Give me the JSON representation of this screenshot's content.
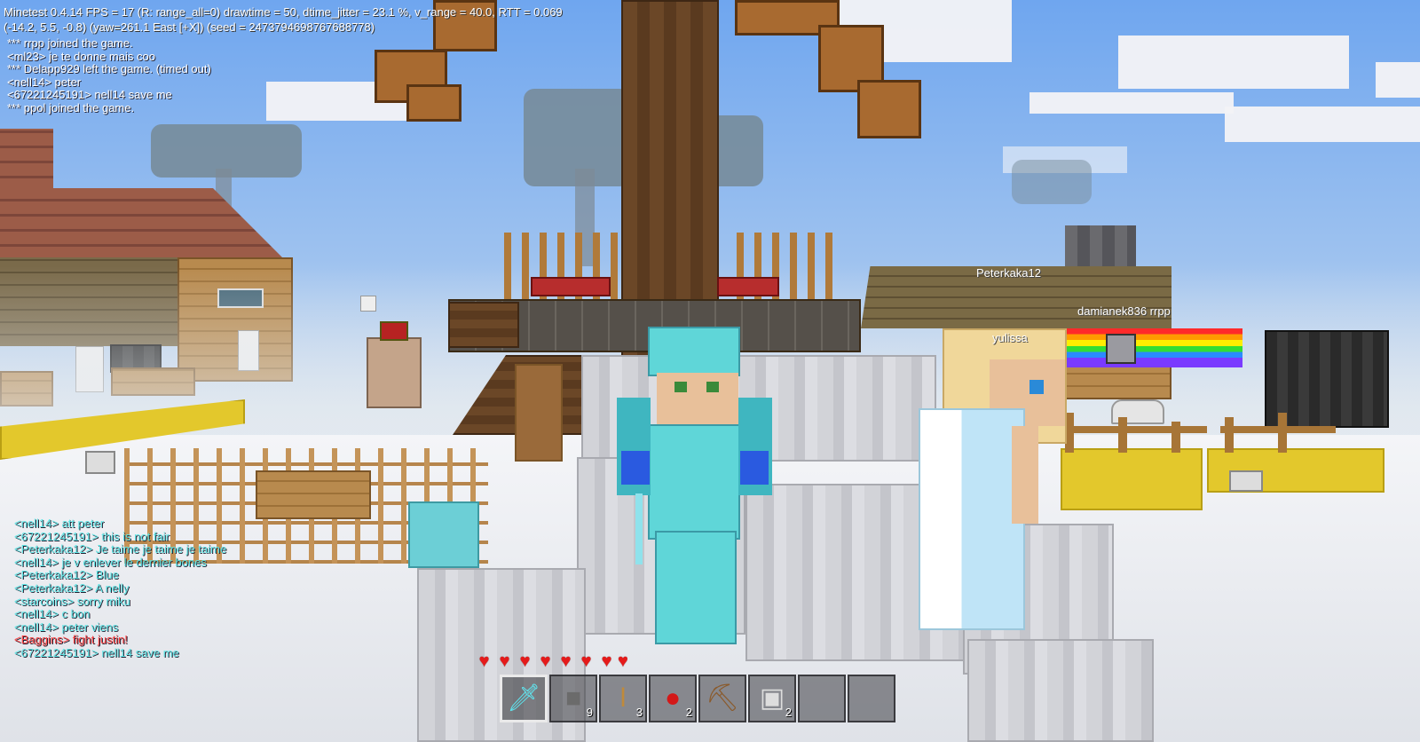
{
  "debug": {
    "line1": "Minetest 0.4.14 FPS = 17 (R: range_all=0) drawtime = 50, dtime_jitter = 23.1 %, v_range = 40.0, RTT = 0.069",
    "line2": "(-14.2, 5.5, -0.8) (yaw=261.1 East [+X]) (seed = 2473794698767688778)"
  },
  "top_chat": [
    {
      "text": "*** rrpp joined the game.",
      "color": "#ffffff"
    },
    {
      "text": "<ml23> je te donne mais coo",
      "color": "#ffffff"
    },
    {
      "text": "*** Delapp929 left the game. (timed out)",
      "color": "#ffffff"
    },
    {
      "text": "<nell14> peter",
      "color": "#ffffff"
    },
    {
      "text": "<67221245191> nell14 save me",
      "color": "#ffffff"
    },
    {
      "text": "*** ppol joined the game.",
      "color": "#ffffff"
    }
  ],
  "bottom_chat": [
    {
      "text": "<nell14> att peter",
      "color": "#5fe6e6"
    },
    {
      "text": "<67221245191> this is not fair",
      "color": "#5fe6e6"
    },
    {
      "text": "<Peterkaka12> Je taime je taime je taime",
      "color": "#5fe6e6"
    },
    {
      "text": "<nell14> je v enlever le dernier bones",
      "color": "#5fe6e6"
    },
    {
      "text": "<Peterkaka12> Blue",
      "color": "#5fe6e6"
    },
    {
      "text": "<Peterkaka12> A nelly",
      "color": "#5fe6e6"
    },
    {
      "text": "<starcoins> sorry miku",
      "color": "#5fe6e6"
    },
    {
      "text": "<nell14> c bon",
      "color": "#5fe6e6"
    },
    {
      "text": "<nell14> peter viens",
      "color": "#5fe6e6"
    },
    {
      "text": "<Baggins> fight justin!",
      "color": "#ff4444"
    },
    {
      "text": "<67221245191> nell14 save me",
      "color": "#5fe6e6"
    }
  ],
  "nametags": {
    "peterkaka": "Peterkaka12",
    "damianek": "damianek836 rrpp",
    "yulissa": "yulissa"
  },
  "health": {
    "hearts_full": 7,
    "hearts_half": 1,
    "max_hearts": 10
  },
  "hotbar": {
    "selected_index": 0,
    "slots": [
      {
        "item": "diamond-sword",
        "glyph": "🗡",
        "color": "#5fe6f0",
        "count": ""
      },
      {
        "item": "stone-block",
        "glyph": "■",
        "color": "#6b6b6b",
        "count": "9"
      },
      {
        "item": "torch",
        "glyph": "ǀ",
        "color": "#c08a3a",
        "count": "3"
      },
      {
        "item": "apple",
        "glyph": "●",
        "color": "#d41818",
        "count": "2"
      },
      {
        "item": "pickaxe",
        "glyph": "⛏",
        "color": "#8a5a2b",
        "count": ""
      },
      {
        "item": "speaker-block",
        "glyph": "▣",
        "color": "#dddddd",
        "count": "2"
      },
      {
        "item": "empty",
        "glyph": "",
        "color": "#ffffff",
        "count": ""
      },
      {
        "item": "empty",
        "glyph": "",
        "color": "#ffffff",
        "count": ""
      }
    ]
  }
}
